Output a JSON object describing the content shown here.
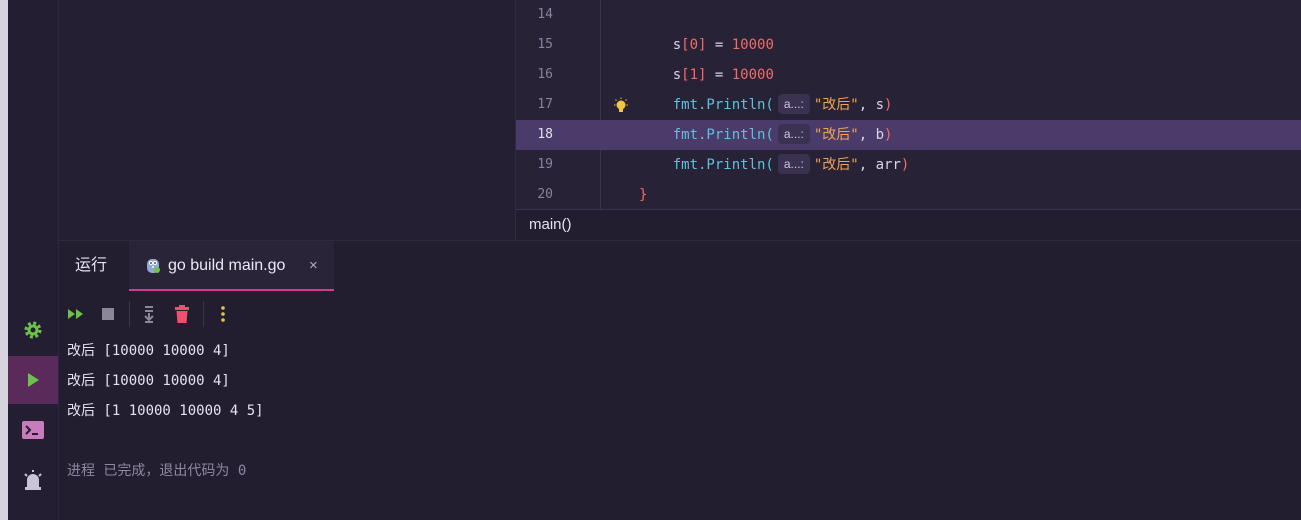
{
  "editor": {
    "lines": [
      {
        "num": "14",
        "segments": []
      },
      {
        "num": "15",
        "segments": [
          {
            "t": "    s",
            "c": ""
          },
          {
            "t": "[0]",
            "c": "num"
          },
          {
            "t": " = ",
            "c": ""
          },
          {
            "t": "10000",
            "c": "num"
          }
        ]
      },
      {
        "num": "16",
        "segments": [
          {
            "t": "    s",
            "c": ""
          },
          {
            "t": "[1]",
            "c": "num"
          },
          {
            "t": " = ",
            "c": ""
          },
          {
            "t": "10000",
            "c": "num"
          }
        ]
      },
      {
        "num": "17",
        "bulb": true,
        "segments": [
          {
            "t": "    fmt.Println(",
            "c": "fmt"
          },
          {
            "t": "a...:",
            "c": "hint"
          },
          {
            "t": "\"改后\"",
            "c": "str"
          },
          {
            "t": ", s",
            "c": ""
          },
          {
            "t": ")",
            "c": "num"
          }
        ]
      },
      {
        "num": "18",
        "current": true,
        "segments": [
          {
            "t": "    fmt.Println(",
            "c": "fmt"
          },
          {
            "t": "a...:",
            "c": "hint"
          },
          {
            "t": "\"改后\"",
            "c": "str"
          },
          {
            "t": ", b",
            "c": ""
          },
          {
            "t": ")",
            "c": "num"
          }
        ]
      },
      {
        "num": "19",
        "segments": [
          {
            "t": "    fmt.Println(",
            "c": "fmt"
          },
          {
            "t": "a...:",
            "c": "hint"
          },
          {
            "t": "\"改后\"",
            "c": "str"
          },
          {
            "t": ", arr",
            "c": ""
          },
          {
            "t": ")",
            "c": "num"
          }
        ]
      },
      {
        "num": "20",
        "segments": [
          {
            "t": "}",
            "c": "brace"
          }
        ]
      }
    ],
    "breadcrumb": "main()"
  },
  "run_panel": {
    "title": "运行",
    "tab_label": "go build main.go",
    "tab_close": "×"
  },
  "console": {
    "lines": [
      "改后 [10000 10000 4]",
      "改后 [10000 10000 4]",
      "改后 [1 10000 10000 4 5]",
      "",
      "进程 已完成，退出代码为 0"
    ]
  },
  "icons": {
    "tool_strip": [
      "gear-icon",
      "run-icon",
      "terminal-icon",
      "alarm-icon"
    ],
    "toolbar": [
      "rerun-icon",
      "stop-icon",
      "scroll-to-end-icon",
      "clear-icon",
      "more-icon"
    ]
  },
  "colors": {
    "accent_tab_underline": "#d23c8c",
    "active_tool": "#5a2b5a",
    "current_line": "#4b3b6b",
    "green": "#6cc24a",
    "red": "#f0506e"
  }
}
